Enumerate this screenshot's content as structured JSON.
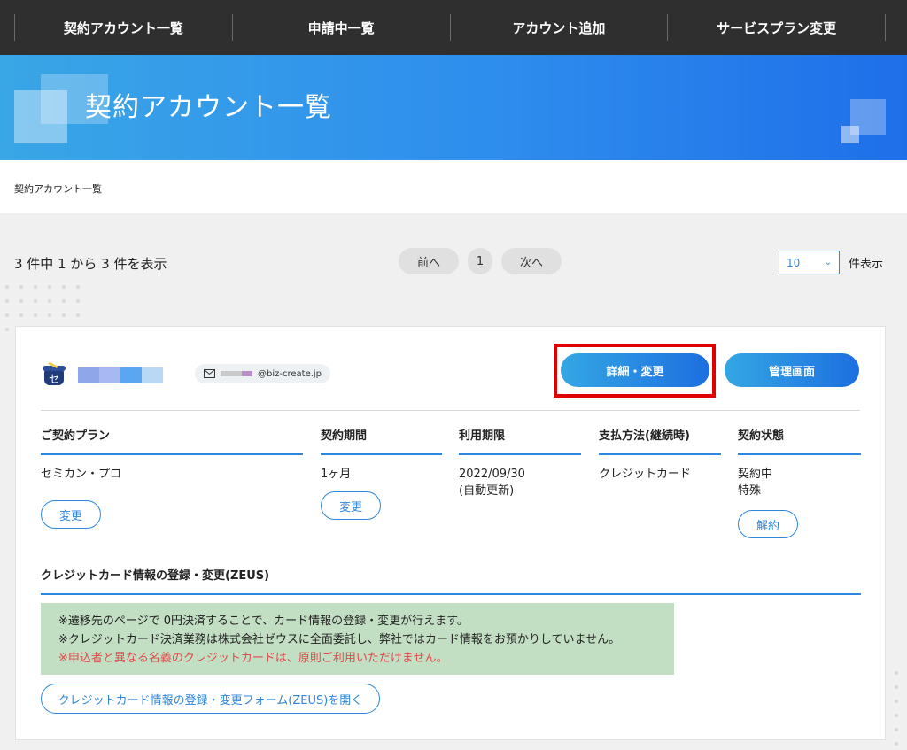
{
  "nav": {
    "items": [
      {
        "label": "契約アカウント一覧"
      },
      {
        "label": "申請中一覧"
      },
      {
        "label": "アカウント追加"
      },
      {
        "label": "サービスプラン変更"
      }
    ]
  },
  "hero": {
    "title": "契約アカウント一覧"
  },
  "breadcrumb": {
    "current": "契約アカウント一覧"
  },
  "listing": {
    "count_text": "3 件中 1 から 3 件を表示",
    "pager": {
      "prev": "前へ",
      "page": "1",
      "next": "次へ"
    },
    "per_page": {
      "value": "10",
      "label": "件表示"
    }
  },
  "account": {
    "email_domain": "@biz-create.jp",
    "detail_button": "詳細・変更",
    "admin_button": "管理画面",
    "swatch_colors": [
      "#8fa6e8",
      "#a8b8f0",
      "#5aa6f0",
      "#b8d8f5"
    ],
    "email_mask_colors": [
      "#c9c9c9",
      "#c9c9c9",
      "#b88fc8"
    ],
    "columns": {
      "plan": {
        "header": "ご契約プラン",
        "value": "セミカン・プロ",
        "button": "変更"
      },
      "period": {
        "header": "契約期間",
        "value": "1ヶ月",
        "button": "変更"
      },
      "expiry": {
        "header": "利用期限",
        "value": "2022/09/30",
        "sub": "(自動更新)"
      },
      "payment": {
        "header": "支払方法(継続時)",
        "value": "クレジットカード"
      },
      "status": {
        "header": "契約状態",
        "value": "契約中",
        "sub": "特殊",
        "button": "解約"
      }
    },
    "credit": {
      "title": "クレジットカード情報の登録・変更(ZEUS)",
      "notice_lines": [
        "※遷移先のページで 0円決済することで、カード情報の登録・変更が行えます。",
        "※クレジットカード決済業務は株式会社ゼウスに全面委託し、弊社ではカード情報をお預かりしていません。"
      ],
      "notice_warning": "※申込者と異なる名義のクレジットカードは、原則ご利用いただけません。",
      "open_button": "クレジットカード情報の登録・変更フォーム(ZEUS)を開く"
    }
  }
}
